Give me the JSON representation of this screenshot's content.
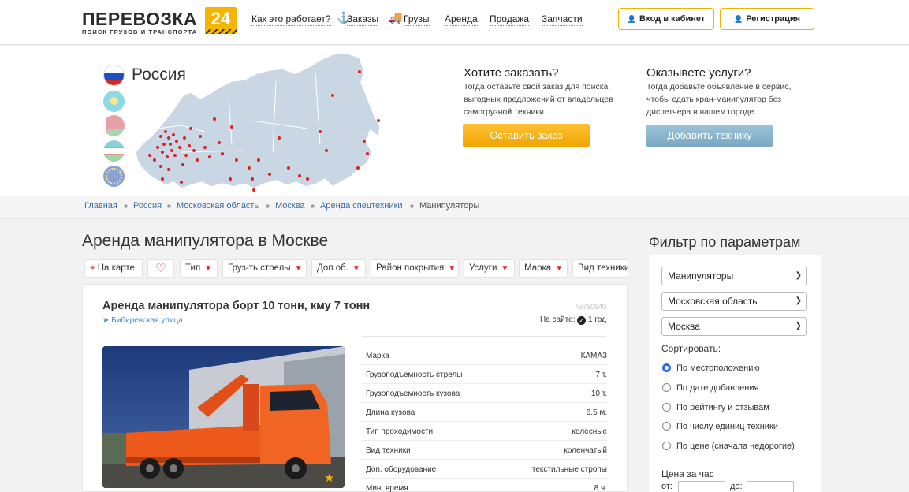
{
  "header": {
    "logo_text": "ПЕРЕВОЗКА",
    "logo_badge": "24",
    "logo_sub": "ПОИСК ГРУЗОВ И ТРАНСПОРТА",
    "nav": [
      {
        "label": "Как это работает?"
      },
      {
        "label": "Заказы",
        "icon": "crane-icon"
      },
      {
        "label": "Грузы",
        "icon": "truck-icon"
      },
      {
        "label": "Аренда"
      },
      {
        "label": "Продажа"
      },
      {
        "label": "Запчасти"
      }
    ],
    "login_label": "Вход в кабинет",
    "register_label": "Регистрация",
    "accent": "#f0b400"
  },
  "hero": {
    "country": "Россия",
    "order": {
      "title": "Хотите заказать?",
      "text": "Тогда оставьте свой заказ для поиска выгодных предложений от владельцев самогрузной техники.",
      "button": "Оставить заказ"
    },
    "offer": {
      "title": "Оказывете услуги?",
      "text": "Тогда добавьте объявление в сервис, чтобы сдать кран-манипулятор без диспетчера в вашем городе.",
      "button": "Добавить технику"
    }
  },
  "breadcrumbs": [
    "Главная",
    "Россия",
    "Московская область",
    "Москва",
    "Аренда спецтехники",
    "Манипуляторы"
  ],
  "page_title": "Аренда манипулятора в Москве",
  "filters": [
    "На карте",
    "",
    "Тип",
    "Груз-ть стрелы",
    "Доп.об.",
    "Район покрытия",
    "Услуги",
    "Марка",
    "Вид техники"
  ],
  "listing": {
    "title": "Аренда манипулятора борт 10 тонн, кму 7 тонн",
    "location": "Бибиревская улица",
    "number": "№750940",
    "on_site_label": "На сайте:",
    "on_site_value": "1 год",
    "specs": [
      {
        "k": "Марка",
        "v": "КАМАЗ"
      },
      {
        "k": "Грузоподъемность стрелы",
        "v": "7 т."
      },
      {
        "k": "Грузоподъемность кузова",
        "v": "10 т."
      },
      {
        "k": "Длина кузова",
        "v": "6.5 м."
      },
      {
        "k": "Тип проходимости",
        "v": "колесные"
      },
      {
        "k": "Вид техники",
        "v": "коленчатый"
      },
      {
        "k": "Доп. оборудование",
        "v": "текстильные стропы"
      },
      {
        "k": "Мин. время",
        "v": "8 ч."
      }
    ]
  },
  "sidebar": {
    "title": "Фильтр по параметрам",
    "selects": [
      "Манипуляторы",
      "Московская область",
      "Москва"
    ],
    "sort_label": "Сортировать:",
    "sort_options": [
      "По местоположению",
      "По дате добавления",
      "По рейтингу и отзывам",
      "По числу единиц техники",
      "По цене (сначала недорогие)"
    ],
    "sort_selected": 0,
    "price_label": "Цена за час",
    "from_label": "от:",
    "to_label": "до:"
  }
}
